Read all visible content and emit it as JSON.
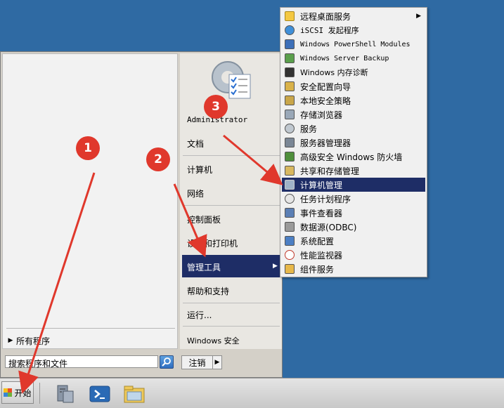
{
  "start_menu": {
    "all_programs": "所有程序",
    "search_placeholder": "搜索程序和文件",
    "right_items": [
      "Administrator",
      "文档",
      "计算机",
      "网络",
      "控制面板",
      "设备和打印机",
      "管理工具",
      "帮助和支持",
      "运行...",
      "Windows 安全"
    ],
    "logoff": "注销"
  },
  "admin_tools_menu": {
    "items": [
      "远程桌面服务",
      "iSCSI 发起程序",
      "Windows PowerShell Modules",
      "Windows Server Backup",
      "Windows 内存诊断",
      "安全配置向导",
      "本地安全策略",
      "存储浏览器",
      "服务",
      "服务器管理器",
      "高级安全 Windows 防火墙",
      "共享和存储管理",
      "计算机管理",
      "任务计划程序",
      "事件查看器",
      "数据源(ODBC)",
      "系统配置",
      "性能监视器",
      "组件服务"
    ],
    "highlighted": "计算机管理"
  },
  "taskbar": {
    "start_label": "开始",
    "icons": [
      "server-manager-icon",
      "powershell-icon",
      "explorer-icon"
    ]
  },
  "annotations": [
    "1",
    "2",
    "3"
  ],
  "colors": {
    "desktop": "#2f6aa3",
    "highlight": "#1e2d66",
    "annotation": "#e0382c"
  }
}
